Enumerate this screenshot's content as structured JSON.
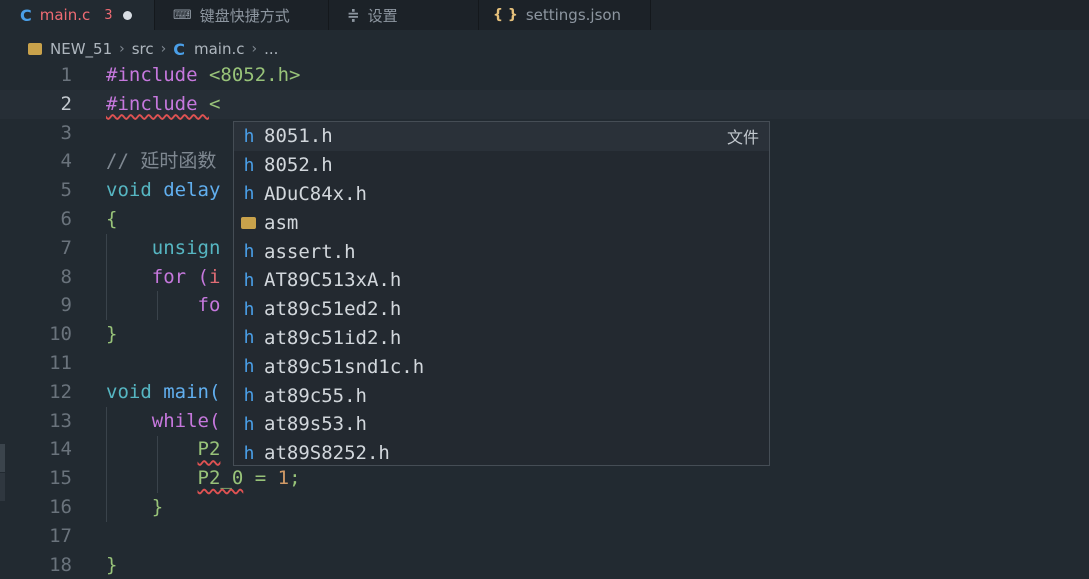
{
  "tabs": [
    {
      "label": "main.c",
      "icon": "c-file-icon",
      "glyph": "C",
      "count": "3"
    },
    {
      "label": "键盘快捷方式",
      "icon": "keyboard-icon",
      "glyph": "⌨"
    },
    {
      "label": "设置",
      "icon": "settings-icon",
      "glyph": "≑"
    },
    {
      "label": "settings.json",
      "icon": "json-icon",
      "glyph": "{ }"
    }
  ],
  "breadcrumb": {
    "folder": "NEW_51",
    "dir": "src",
    "file": "main.c",
    "tail": "...",
    "file_glyph": "C"
  },
  "lines": [
    {
      "n": "1",
      "t": [
        "#include ",
        "<8052.h>"
      ]
    },
    {
      "n": "2",
      "t": [
        "#include ",
        "<"
      ]
    },
    {
      "n": "3",
      "t": [
        ""
      ]
    },
    {
      "n": "4",
      "t": [
        "// 延时函数"
      ]
    },
    {
      "n": "5",
      "t": [
        "void ",
        "delay"
      ]
    },
    {
      "n": "6",
      "t": [
        "{"
      ]
    },
    {
      "n": "7",
      "t": [
        "    unsign"
      ]
    },
    {
      "n": "8",
      "t": [
        "    for (",
        "i"
      ]
    },
    {
      "n": "9",
      "t": [
        "        fo"
      ]
    },
    {
      "n": "10",
      "t": [
        "}"
      ]
    },
    {
      "n": "11",
      "t": [
        ""
      ]
    },
    {
      "n": "12",
      "t": [
        "void ",
        "main("
      ]
    },
    {
      "n": "13",
      "t": [
        "    while("
      ]
    },
    {
      "n": "14",
      "t": [
        "        ",
        "P2"
      ]
    },
    {
      "n": "15",
      "t": [
        "        ",
        "P2_0",
        " = ",
        "1",
        ";"
      ]
    },
    {
      "n": "16",
      "t": [
        "    }"
      ]
    },
    {
      "n": "17",
      "t": [
        ""
      ]
    },
    {
      "n": "18",
      "t": [
        "}"
      ]
    }
  ],
  "suggestions": [
    {
      "label": "8051.h",
      "kind": "文件"
    },
    {
      "label": "8052.h"
    },
    {
      "label": "ADuC84x.h"
    },
    {
      "label": "asm",
      "folder": true
    },
    {
      "label": "assert.h"
    },
    {
      "label": "AT89C513xA.h"
    },
    {
      "label": "at89c51ed2.h"
    },
    {
      "label": "at89c51id2.h"
    },
    {
      "label": "at89c51snd1c.h"
    },
    {
      "label": "at89c55.h"
    },
    {
      "label": "at89s53.h"
    },
    {
      "label": "at89S8252.h"
    }
  ],
  "header_glyph": "h"
}
